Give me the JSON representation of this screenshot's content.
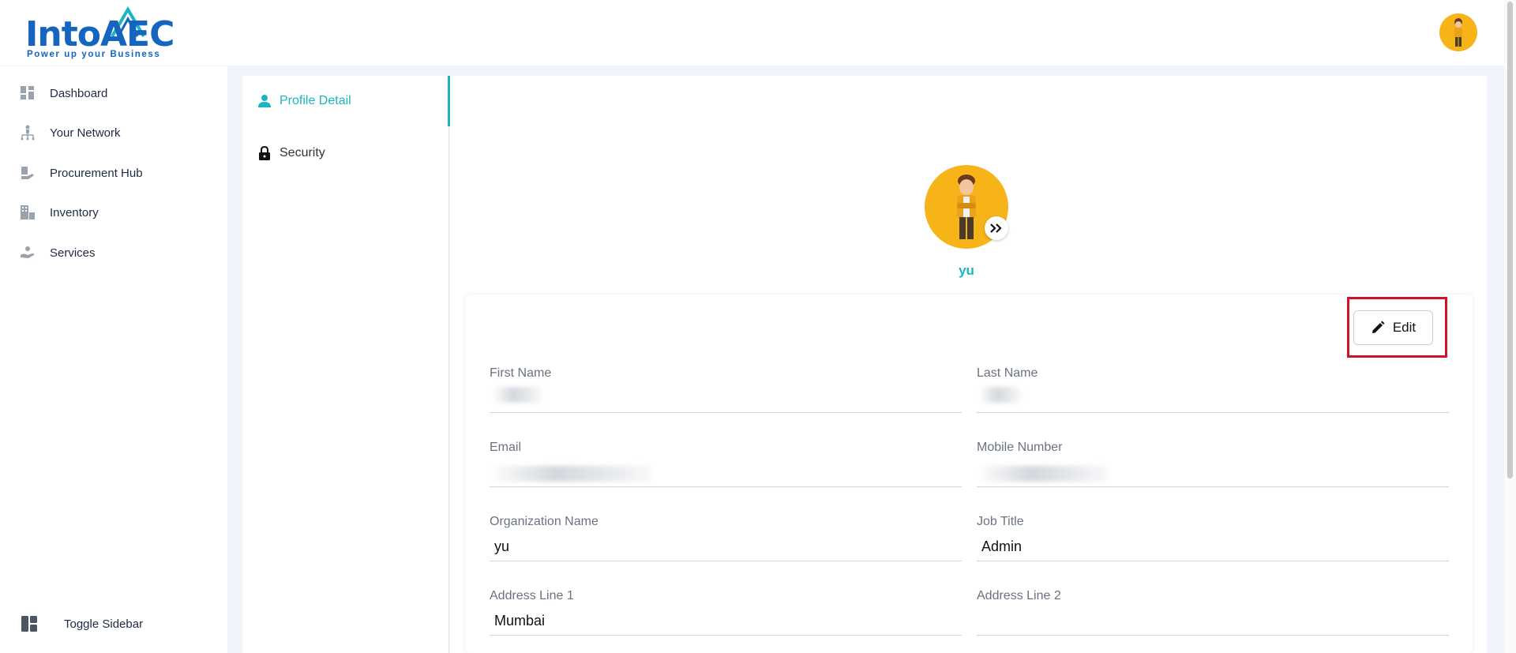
{
  "header": {
    "logo_word": "IntoAEC",
    "logo_tagline": "Power up your Business",
    "avatar_icon": "user-avatar-icon"
  },
  "sidebar": {
    "items": [
      {
        "label": "Dashboard",
        "icon": "dashboard-icon"
      },
      {
        "label": "Your Network",
        "icon": "network-icon"
      },
      {
        "label": "Procurement Hub",
        "icon": "procurement-icon"
      },
      {
        "label": "Inventory",
        "icon": "inventory-icon"
      },
      {
        "label": "Services",
        "icon": "services-icon"
      }
    ],
    "toggle_label": "Toggle Sidebar"
  },
  "settings": {
    "items": [
      {
        "label": "Profile Detail",
        "icon": "person-icon",
        "active": true
      },
      {
        "label": "Security",
        "icon": "lock-icon",
        "active": false
      }
    ]
  },
  "profile": {
    "name": "yu",
    "edit_label": "Edit"
  },
  "form": {
    "fields": [
      {
        "label": "First Name",
        "value": ""
      },
      {
        "label": "Last Name",
        "value": ""
      },
      {
        "label": "Email",
        "value": ""
      },
      {
        "label": "Mobile Number",
        "value": ""
      },
      {
        "label": "Organization Name",
        "value": "yu"
      },
      {
        "label": "Job Title",
        "value": "Admin"
      },
      {
        "label": "Address Line 1",
        "value": "Mumbai"
      },
      {
        "label": "Address Line 2",
        "value": ""
      }
    ]
  },
  "colors": {
    "accent": "#1ab5c1",
    "brand": "#1565c0",
    "highlight": "#d1102a",
    "avatar_bg": "#f6b418"
  }
}
